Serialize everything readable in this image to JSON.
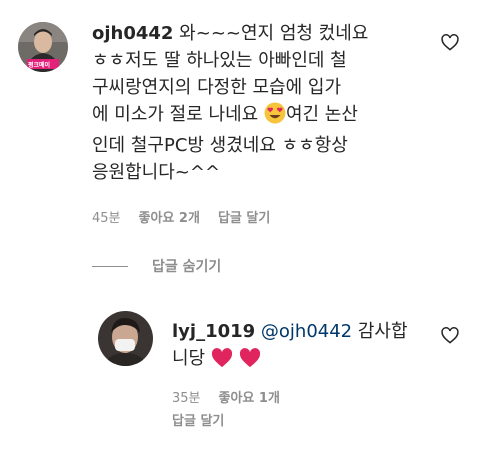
{
  "comment": {
    "username": "ojh0442",
    "avatar_badge": "평크메이",
    "lines": [
      " 와~~~연지 엄청 컸네요",
      "ㅎㅎ저도 딸 하나있는 아빠인데 철",
      "구씨랑연지의 다정한 모습에 입가",
      "에 미소가 절로 나네요",
      "여긴 논산",
      "인데 철구PC방 생겼네요 ㅎㅎ항상",
      "응원합니다~^^"
    ],
    "emoji": "heart-eyes-emoji",
    "time": "45분",
    "likes": "좋아요 2개",
    "reply": "답글 달기"
  },
  "hide_replies_label": "답글 숨기기",
  "reply_comment": {
    "username": "lyj_1019",
    "mention": "@ojh0442",
    "line1_text": " 감사합",
    "line2_text": "니당",
    "time": "35분",
    "likes": "좋아요 1개",
    "reply": "답글 달기"
  },
  "colors": {
    "text": "#262626",
    "meta": "#8e8e8e",
    "mention": "#00376b",
    "heart": "#e0245e"
  }
}
